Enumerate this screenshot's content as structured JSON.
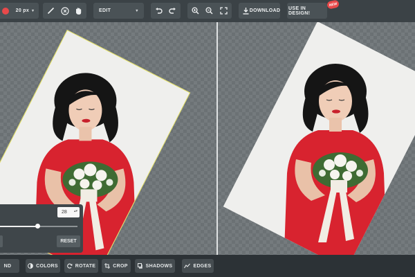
{
  "toolbar": {
    "brush_size": "20 px",
    "mode": "EDIT",
    "download_label": "DOWNLOAD",
    "design_label": "USE IN DESIGN!",
    "new_badge": "NEW"
  },
  "panel": {
    "angle_value": "28",
    "slider_value_fraction": 0.48,
    "reset_label": "RESET"
  },
  "bottom": {
    "tools": [
      {
        "label": "ND",
        "icon": "background-icon"
      },
      {
        "label": "COLORS",
        "icon": "colors-icon"
      },
      {
        "label": "ROTATE",
        "icon": "rotate-icon"
      },
      {
        "label": "CROP",
        "icon": "crop-icon"
      },
      {
        "label": "SHADOWS",
        "icon": "shadows-icon"
      },
      {
        "label": "EDGES",
        "icon": "edges-icon"
      }
    ]
  },
  "colors": {
    "accent_red": "#e8494a",
    "toolbar_bg": "#3b4246",
    "selection_outline": "#e3e05a"
  }
}
